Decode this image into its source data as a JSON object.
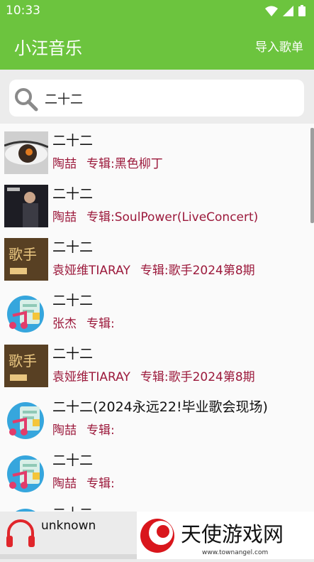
{
  "status": {
    "time": "10:33"
  },
  "appbar": {
    "title": "小汪音乐",
    "import_label": "导入歌单"
  },
  "search": {
    "value": "二十二"
  },
  "songs": [
    {
      "title": "二十二",
      "artist": "陶喆",
      "album": "专辑:黑色柳丁",
      "art": "eye"
    },
    {
      "title": "二十二",
      "artist": "陶喆",
      "album": "专辑:SoulPower(LiveConcert)",
      "art": "concert"
    },
    {
      "title": "二十二",
      "artist": "袁娅维TIARAY",
      "album": "专辑:歌手2024第8期",
      "art": "singer"
    },
    {
      "title": "二十二",
      "artist": "张杰",
      "album": "专辑:",
      "art": "default"
    },
    {
      "title": "二十二",
      "artist": "袁娅维TIARAY",
      "album": "专辑:歌手2024第8期",
      "art": "singer"
    },
    {
      "title": "二十二(2024永远22!毕业歌会现场)",
      "artist": "陶喆",
      "album": "专辑:",
      "art": "default"
    },
    {
      "title": "二十二",
      "artist": "陶喆",
      "album": "专辑:",
      "art": "default"
    },
    {
      "title": "二十二",
      "artist": "",
      "album": "",
      "art": "default"
    }
  ],
  "player": {
    "track": "unknown",
    "icon": "headphones-icon"
  },
  "watermark": {
    "site": "天使游戏网",
    "url": "www.townangel.com"
  },
  "colors": {
    "accent": "#6cc43e",
    "artist": "#9c1a3c"
  }
}
